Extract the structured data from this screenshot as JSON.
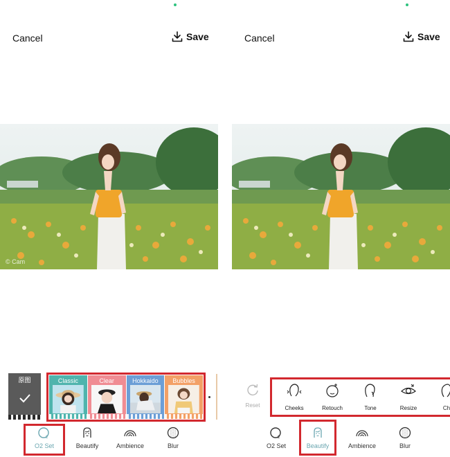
{
  "left": {
    "cancel": "Cancel",
    "save": "Save",
    "watermark": "© Cam",
    "original_label": "原图",
    "filters": [
      {
        "name": "Classic",
        "color": "#4fb4ad"
      },
      {
        "name": "Clear",
        "color": "#f08c93"
      },
      {
        "name": "Hokkaido",
        "color": "#6c9ed6"
      },
      {
        "name": "Bubbles",
        "color": "#f3a066"
      }
    ],
    "tabs": [
      {
        "label": "O2 Set",
        "icon": "o2-set-icon"
      },
      {
        "label": "Beautify",
        "icon": "face-icon"
      },
      {
        "label": "Ambience",
        "icon": "rainbow-icon"
      },
      {
        "label": "Blur",
        "icon": "blur-circle-icon"
      }
    ],
    "active_tab": "O2 Set"
  },
  "right": {
    "cancel": "Cancel",
    "save": "Save",
    "reset": "Reset",
    "tools": [
      {
        "label": "Cheeks",
        "icon": "cheeks-icon"
      },
      {
        "label": "Retouch",
        "icon": "retouch-icon"
      },
      {
        "label": "Tone",
        "icon": "tone-icon"
      },
      {
        "label": "Resize",
        "icon": "eye-resize-icon"
      },
      {
        "label": "Ch",
        "icon": "chin-icon"
      }
    ],
    "tabs": [
      {
        "label": "O2 Set",
        "icon": "o2-set-icon"
      },
      {
        "label": "Beautify",
        "icon": "face-icon"
      },
      {
        "label": "Ambience",
        "icon": "rainbow-icon"
      },
      {
        "label": "Blur",
        "icon": "blur-circle-icon"
      }
    ],
    "active_tab": "Beautify"
  },
  "colors": {
    "highlight": "#d2282e",
    "active_tab": "#6aa6b0",
    "status_dot": "#2ec27e"
  }
}
